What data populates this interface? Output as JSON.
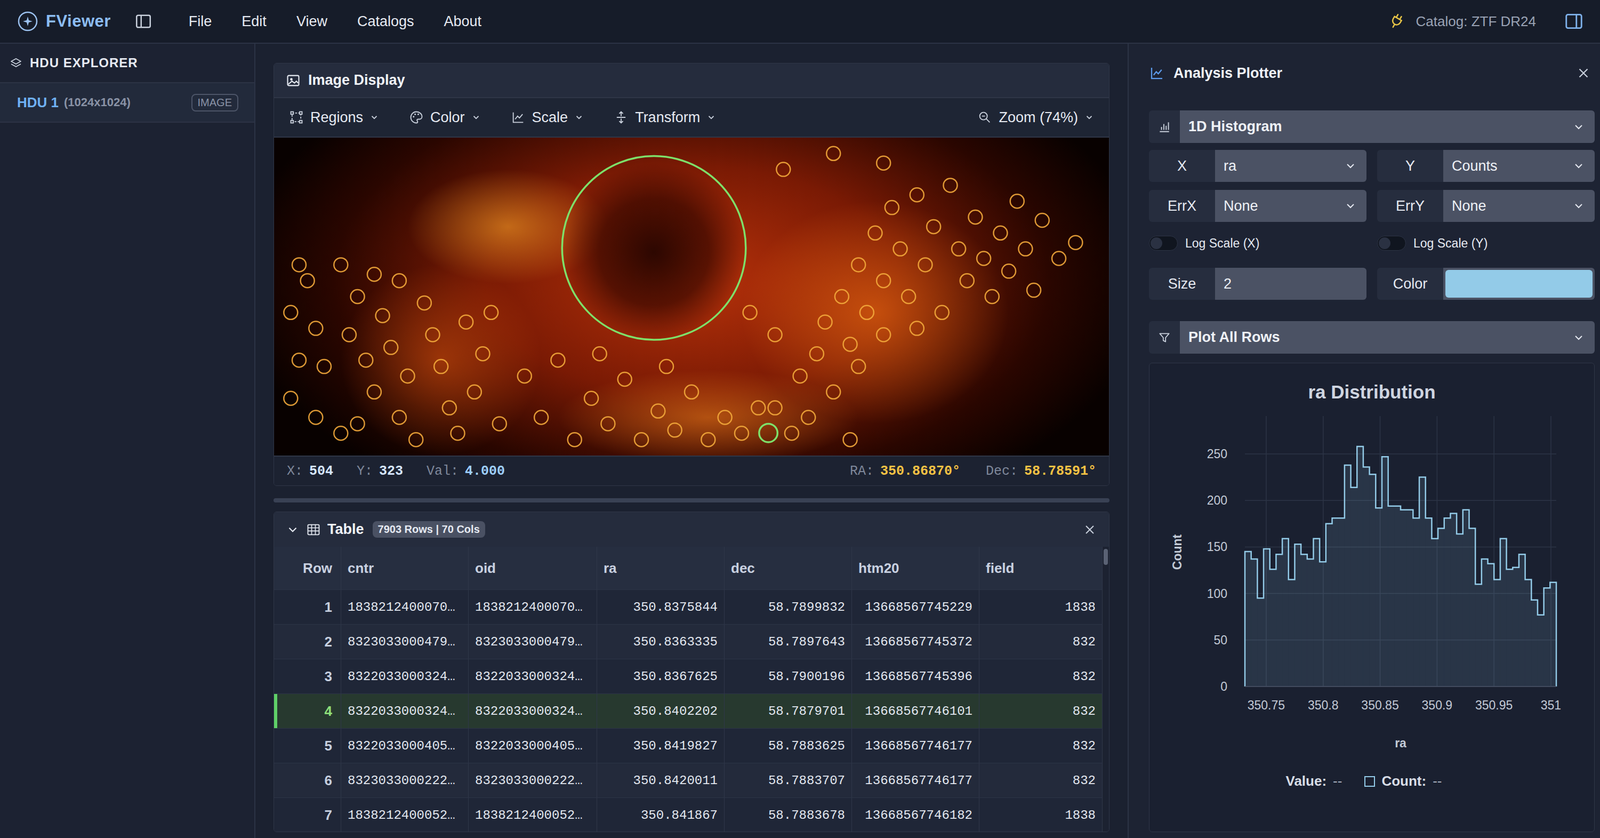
{
  "app": {
    "title": "FViewer"
  },
  "menu": [
    "File",
    "Edit",
    "View",
    "Catalogs",
    "About"
  ],
  "catalog_status": "Catalog: ZTF DR24",
  "sidebar": {
    "title": "HDU EXPLORER",
    "items": [
      {
        "name": "HDU 1",
        "dims": "(1024x1024)",
        "badge": "IMAGE",
        "selected": true
      }
    ]
  },
  "image_display": {
    "title": "Image Display",
    "toolbar": {
      "regions": "Regions",
      "color": "Color",
      "scale": "Scale",
      "transform": "Transform",
      "zoom": "Zoom (74%)"
    },
    "regions": [
      {
        "cx": 0.455,
        "cy": 0.347,
        "r": 0.11
      },
      {
        "cx": 0.592,
        "cy": 0.929,
        "r": 0.011
      }
    ],
    "markers": [
      [
        0.03,
        0.4
      ],
      [
        0.04,
        0.45
      ],
      [
        0.02,
        0.55
      ],
      [
        0.05,
        0.6
      ],
      [
        0.03,
        0.7
      ],
      [
        0.06,
        0.72
      ],
      [
        0.02,
        0.82
      ],
      [
        0.05,
        0.88
      ],
      [
        0.08,
        0.93
      ],
      [
        0.1,
        0.5
      ],
      [
        0.09,
        0.62
      ],
      [
        0.11,
        0.7
      ],
      [
        0.12,
        0.8
      ],
      [
        0.1,
        0.9
      ],
      [
        0.13,
        0.56
      ],
      [
        0.15,
        0.45
      ],
      [
        0.14,
        0.66
      ],
      [
        0.16,
        0.75
      ],
      [
        0.15,
        0.88
      ],
      [
        0.18,
        0.52
      ],
      [
        0.19,
        0.62
      ],
      [
        0.17,
        0.95
      ],
      [
        0.2,
        0.72
      ],
      [
        0.21,
        0.85
      ],
      [
        0.23,
        0.58
      ],
      [
        0.22,
        0.93
      ],
      [
        0.25,
        0.68
      ],
      [
        0.24,
        0.8
      ],
      [
        0.27,
        0.9
      ],
      [
        0.26,
        0.55
      ],
      [
        0.08,
        0.4
      ],
      [
        0.12,
        0.43
      ],
      [
        0.3,
        0.75
      ],
      [
        0.32,
        0.88
      ],
      [
        0.34,
        0.7
      ],
      [
        0.36,
        0.95
      ],
      [
        0.38,
        0.82
      ],
      [
        0.4,
        0.9
      ],
      [
        0.42,
        0.76
      ],
      [
        0.44,
        0.95
      ],
      [
        0.46,
        0.86
      ],
      [
        0.48,
        0.92
      ],
      [
        0.5,
        0.8
      ],
      [
        0.52,
        0.95
      ],
      [
        0.54,
        0.88
      ],
      [
        0.56,
        0.93
      ],
      [
        0.58,
        0.85
      ],
      [
        0.47,
        0.72
      ],
      [
        0.39,
        0.68
      ],
      [
        0.6,
        0.85
      ],
      [
        0.62,
        0.93
      ],
      [
        0.63,
        0.75
      ],
      [
        0.65,
        0.68
      ],
      [
        0.64,
        0.88
      ],
      [
        0.66,
        0.58
      ],
      [
        0.67,
        0.8
      ],
      [
        0.68,
        0.5
      ],
      [
        0.69,
        0.65
      ],
      [
        0.7,
        0.4
      ],
      [
        0.71,
        0.55
      ],
      [
        0.72,
        0.3
      ],
      [
        0.73,
        0.45
      ],
      [
        0.7,
        0.72
      ],
      [
        0.74,
        0.22
      ],
      [
        0.75,
        0.35
      ],
      [
        0.76,
        0.5
      ],
      [
        0.77,
        0.18
      ],
      [
        0.78,
        0.4
      ],
      [
        0.79,
        0.28
      ],
      [
        0.8,
        0.55
      ],
      [
        0.81,
        0.15
      ],
      [
        0.82,
        0.35
      ],
      [
        0.83,
        0.45
      ],
      [
        0.84,
        0.25
      ],
      [
        0.85,
        0.38
      ],
      [
        0.86,
        0.5
      ],
      [
        0.87,
        0.3
      ],
      [
        0.88,
        0.42
      ],
      [
        0.89,
        0.2
      ],
      [
        0.9,
        0.35
      ],
      [
        0.91,
        0.48
      ],
      [
        0.92,
        0.26
      ],
      [
        0.94,
        0.38
      ],
      [
        0.96,
        0.33
      ],
      [
        0.69,
        0.95
      ],
      [
        0.73,
        0.62
      ],
      [
        0.77,
        0.6
      ],
      [
        0.57,
        0.55
      ],
      [
        0.6,
        0.62
      ],
      [
        0.67,
        0.05
      ],
      [
        0.73,
        0.08
      ],
      [
        0.61,
        0.1
      ]
    ],
    "status": {
      "x_label": "X:",
      "x": "504",
      "y_label": "Y:",
      "y": "323",
      "val_label": "Val:",
      "val": "4.000",
      "ra_label": "RA:",
      "ra": "350.86870°",
      "dec_label": "Dec:",
      "dec": "58.78591°"
    }
  },
  "table": {
    "title": "Table",
    "badge": "7903 Rows | 70 Cols",
    "columns": [
      {
        "label": "Row",
        "kind": "index"
      },
      {
        "label": "cntr",
        "kind": "text"
      },
      {
        "label": "oid",
        "kind": "text"
      },
      {
        "label": "ra",
        "kind": "number"
      },
      {
        "label": "dec",
        "kind": "number"
      },
      {
        "label": "htm20",
        "kind": "number"
      },
      {
        "label": "field",
        "kind": "number"
      }
    ],
    "rows": [
      {
        "cells": [
          "1",
          "1838212400070…",
          "1838212400070…",
          "350.8375844",
          "58.7899832",
          "13668567745229",
          "1838"
        ],
        "selected": false
      },
      {
        "cells": [
          "2",
          "8323033000479…",
          "8323033000479…",
          "350.8363335",
          "58.7897643",
          "13668567745372",
          "832"
        ],
        "selected": false
      },
      {
        "cells": [
          "3",
          "8322033000324…",
          "8322033000324…",
          "350.8367625",
          "58.7900196",
          "13668567745396",
          "832"
        ],
        "selected": false
      },
      {
        "cells": [
          "4",
          "8322033000324…",
          "8322033000324…",
          "350.8402202",
          "58.7879701",
          "13668567746101",
          "832"
        ],
        "selected": true
      },
      {
        "cells": [
          "5",
          "8322033000405…",
          "8322033000405…",
          "350.8419827",
          "58.7883625",
          "13668567746177",
          "832"
        ],
        "selected": false
      },
      {
        "cells": [
          "6",
          "8323033000222…",
          "8323033000222…",
          "350.8420011",
          "58.7883707",
          "13668567746177",
          "832"
        ],
        "selected": false
      },
      {
        "cells": [
          "7",
          "1838212400052…",
          "1838212400052…",
          "350.841867",
          "58.7883678",
          "13668567746182",
          "1838"
        ],
        "selected": false
      }
    ]
  },
  "plotter": {
    "title": "Analysis Plotter",
    "plot_type": "1D Histogram",
    "fields": [
      {
        "label": "X",
        "value": "ra"
      },
      {
        "label": "Y",
        "value": "Counts"
      },
      {
        "label": "ErrX",
        "value": "None"
      },
      {
        "label": "ErrY",
        "value": "None"
      }
    ],
    "toggles": [
      {
        "label": "Log Scale (X)",
        "on": false
      },
      {
        "label": "Log Scale (Y)",
        "on": false
      }
    ],
    "size": {
      "label": "Size",
      "value": "2"
    },
    "color": {
      "label": "Color",
      "value": "#93cbe8"
    },
    "filter": "Plot All Rows",
    "chart": {
      "title": "ra Distribution",
      "y_label": "Count",
      "x_label": "ra",
      "y_ticks": [
        "0",
        "50",
        "100",
        "150",
        "200",
        "250"
      ],
      "x_ticks": [
        "350.75",
        "350.8",
        "350.85",
        "350.9",
        "350.95",
        "351"
      ],
      "x_domain": [
        350.7313,
        351.0047
      ],
      "y_domain": [
        0,
        290.7
      ],
      "counts": [
        145,
        137,
        95,
        148,
        126,
        142,
        159,
        115,
        153,
        142,
        137,
        159,
        134,
        175,
        181,
        181,
        238,
        214,
        258,
        236,
        228,
        192,
        247,
        194,
        194,
        190,
        190,
        181,
        225,
        181,
        159,
        170,
        181,
        186,
        164,
        190,
        170,
        110,
        137,
        132,
        115,
        159,
        126,
        128,
        142,
        115,
        93,
        77,
        106,
        112
      ],
      "legend": {
        "value_label": "Value:",
        "value": "--",
        "count_label": "Count:",
        "count": "--"
      }
    }
  }
}
